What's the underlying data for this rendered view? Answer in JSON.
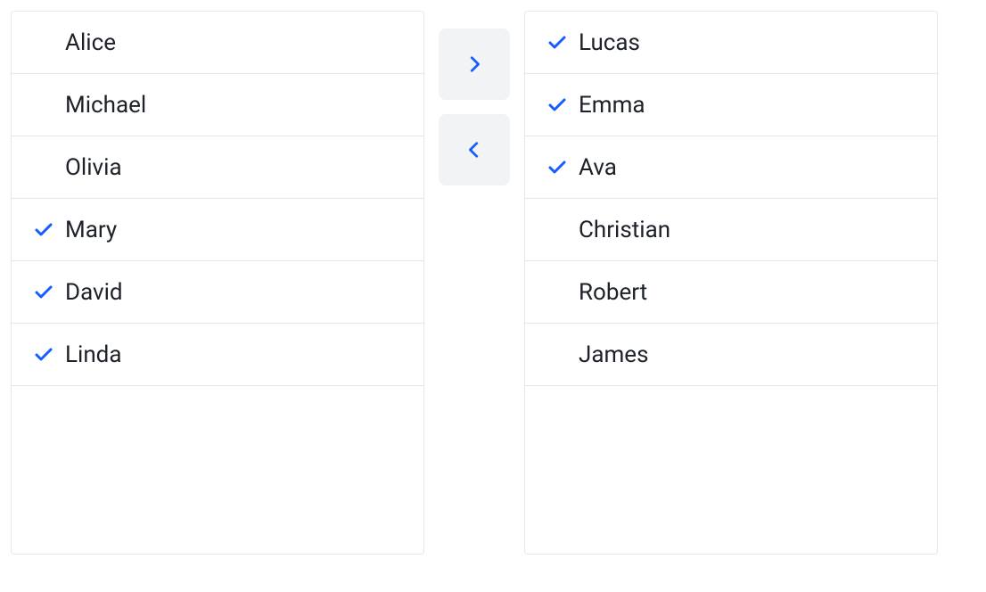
{
  "colors": {
    "accent": "#165dff",
    "border": "#e5e6eb",
    "text": "#1d2129",
    "buttonBg": "#f2f3f5"
  },
  "icons": {
    "check": "check-icon",
    "moveRight": "chevron-right-icon",
    "moveLeft": "chevron-left-icon"
  },
  "source": {
    "items": [
      {
        "label": "Alice",
        "checked": false
      },
      {
        "label": "Michael",
        "checked": false
      },
      {
        "label": "Olivia",
        "checked": false
      },
      {
        "label": "Mary",
        "checked": true
      },
      {
        "label": "David",
        "checked": true
      },
      {
        "label": "Linda",
        "checked": true
      }
    ]
  },
  "target": {
    "items": [
      {
        "label": "Lucas",
        "checked": true
      },
      {
        "label": "Emma",
        "checked": true
      },
      {
        "label": "Ava",
        "checked": true
      },
      {
        "label": "Christian",
        "checked": false
      },
      {
        "label": "Robert",
        "checked": false
      },
      {
        "label": "James",
        "checked": false
      }
    ]
  }
}
